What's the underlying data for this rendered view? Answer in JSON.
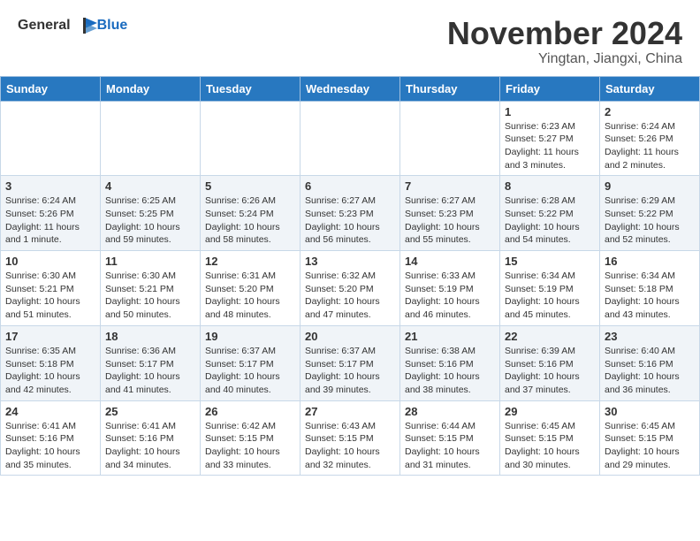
{
  "header": {
    "logo_general": "General",
    "logo_blue": "Blue",
    "month_title": "November 2024",
    "subtitle": "Yingtan, Jiangxi, China"
  },
  "days_of_week": [
    "Sunday",
    "Monday",
    "Tuesday",
    "Wednesday",
    "Thursday",
    "Friday",
    "Saturday"
  ],
  "weeks": [
    [
      {
        "day": "",
        "info": ""
      },
      {
        "day": "",
        "info": ""
      },
      {
        "day": "",
        "info": ""
      },
      {
        "day": "",
        "info": ""
      },
      {
        "day": "",
        "info": ""
      },
      {
        "day": "1",
        "info": "Sunrise: 6:23 AM\nSunset: 5:27 PM\nDaylight: 11 hours and 3 minutes."
      },
      {
        "day": "2",
        "info": "Sunrise: 6:24 AM\nSunset: 5:26 PM\nDaylight: 11 hours and 2 minutes."
      }
    ],
    [
      {
        "day": "3",
        "info": "Sunrise: 6:24 AM\nSunset: 5:26 PM\nDaylight: 11 hours and 1 minute."
      },
      {
        "day": "4",
        "info": "Sunrise: 6:25 AM\nSunset: 5:25 PM\nDaylight: 10 hours and 59 minutes."
      },
      {
        "day": "5",
        "info": "Sunrise: 6:26 AM\nSunset: 5:24 PM\nDaylight: 10 hours and 58 minutes."
      },
      {
        "day": "6",
        "info": "Sunrise: 6:27 AM\nSunset: 5:23 PM\nDaylight: 10 hours and 56 minutes."
      },
      {
        "day": "7",
        "info": "Sunrise: 6:27 AM\nSunset: 5:23 PM\nDaylight: 10 hours and 55 minutes."
      },
      {
        "day": "8",
        "info": "Sunrise: 6:28 AM\nSunset: 5:22 PM\nDaylight: 10 hours and 54 minutes."
      },
      {
        "day": "9",
        "info": "Sunrise: 6:29 AM\nSunset: 5:22 PM\nDaylight: 10 hours and 52 minutes."
      }
    ],
    [
      {
        "day": "10",
        "info": "Sunrise: 6:30 AM\nSunset: 5:21 PM\nDaylight: 10 hours and 51 minutes."
      },
      {
        "day": "11",
        "info": "Sunrise: 6:30 AM\nSunset: 5:21 PM\nDaylight: 10 hours and 50 minutes."
      },
      {
        "day": "12",
        "info": "Sunrise: 6:31 AM\nSunset: 5:20 PM\nDaylight: 10 hours and 48 minutes."
      },
      {
        "day": "13",
        "info": "Sunrise: 6:32 AM\nSunset: 5:20 PM\nDaylight: 10 hours and 47 minutes."
      },
      {
        "day": "14",
        "info": "Sunrise: 6:33 AM\nSunset: 5:19 PM\nDaylight: 10 hours and 46 minutes."
      },
      {
        "day": "15",
        "info": "Sunrise: 6:34 AM\nSunset: 5:19 PM\nDaylight: 10 hours and 45 minutes."
      },
      {
        "day": "16",
        "info": "Sunrise: 6:34 AM\nSunset: 5:18 PM\nDaylight: 10 hours and 43 minutes."
      }
    ],
    [
      {
        "day": "17",
        "info": "Sunrise: 6:35 AM\nSunset: 5:18 PM\nDaylight: 10 hours and 42 minutes."
      },
      {
        "day": "18",
        "info": "Sunrise: 6:36 AM\nSunset: 5:17 PM\nDaylight: 10 hours and 41 minutes."
      },
      {
        "day": "19",
        "info": "Sunrise: 6:37 AM\nSunset: 5:17 PM\nDaylight: 10 hours and 40 minutes."
      },
      {
        "day": "20",
        "info": "Sunrise: 6:37 AM\nSunset: 5:17 PM\nDaylight: 10 hours and 39 minutes."
      },
      {
        "day": "21",
        "info": "Sunrise: 6:38 AM\nSunset: 5:16 PM\nDaylight: 10 hours and 38 minutes."
      },
      {
        "day": "22",
        "info": "Sunrise: 6:39 AM\nSunset: 5:16 PM\nDaylight: 10 hours and 37 minutes."
      },
      {
        "day": "23",
        "info": "Sunrise: 6:40 AM\nSunset: 5:16 PM\nDaylight: 10 hours and 36 minutes."
      }
    ],
    [
      {
        "day": "24",
        "info": "Sunrise: 6:41 AM\nSunset: 5:16 PM\nDaylight: 10 hours and 35 minutes."
      },
      {
        "day": "25",
        "info": "Sunrise: 6:41 AM\nSunset: 5:16 PM\nDaylight: 10 hours and 34 minutes."
      },
      {
        "day": "26",
        "info": "Sunrise: 6:42 AM\nSunset: 5:15 PM\nDaylight: 10 hours and 33 minutes."
      },
      {
        "day": "27",
        "info": "Sunrise: 6:43 AM\nSunset: 5:15 PM\nDaylight: 10 hours and 32 minutes."
      },
      {
        "day": "28",
        "info": "Sunrise: 6:44 AM\nSunset: 5:15 PM\nDaylight: 10 hours and 31 minutes."
      },
      {
        "day": "29",
        "info": "Sunrise: 6:45 AM\nSunset: 5:15 PM\nDaylight: 10 hours and 30 minutes."
      },
      {
        "day": "30",
        "info": "Sunrise: 6:45 AM\nSunset: 5:15 PM\nDaylight: 10 hours and 29 minutes."
      }
    ]
  ]
}
